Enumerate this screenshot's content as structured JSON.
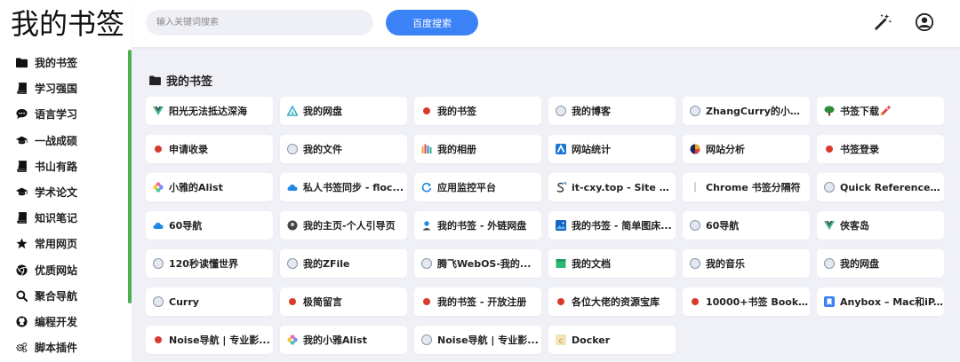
{
  "sidebar": {
    "logo": "我的书签",
    "items": [
      {
        "label": "我的书签",
        "icon": "folder-icon"
      },
      {
        "label": "学习强国",
        "icon": "book-icon"
      },
      {
        "label": "语言学习",
        "icon": "chat-icon"
      },
      {
        "label": "一战成硕",
        "icon": "graduation-cap-icon"
      },
      {
        "label": "书山有路",
        "icon": "book-icon"
      },
      {
        "label": "学术论文",
        "icon": "graduation-cap-icon"
      },
      {
        "label": "知识笔记",
        "icon": "book-icon"
      },
      {
        "label": "常用网页",
        "icon": "star-icon"
      },
      {
        "label": "优质网站",
        "icon": "chrome-icon"
      },
      {
        "label": "聚合导航",
        "icon": "search-icon"
      },
      {
        "label": "编程开发",
        "icon": "github-icon"
      },
      {
        "label": "脚本插件",
        "icon": "gears-icon"
      }
    ]
  },
  "header": {
    "search_placeholder": "输入关键词搜索",
    "search_button": "百度搜索"
  },
  "section": {
    "title": "我的书签"
  },
  "bookmarks": [
    {
      "label": "阳光无法抵达深海",
      "icon": "vue-icon"
    },
    {
      "label": "我的网盘",
      "icon": "triangle-icon"
    },
    {
      "label": "我的书签",
      "icon": "red-dot-icon"
    },
    {
      "label": "我的博客",
      "icon": "globe-icon"
    },
    {
      "label": "ZhangCurry的小破站",
      "icon": "globe-icon"
    },
    {
      "label": "书签下载",
      "icon": "tree-icon",
      "badge": "rocket-icon"
    },
    {
      "label": "申请收录",
      "icon": "red-dot-icon"
    },
    {
      "label": "我的文件",
      "icon": "globe-icon"
    },
    {
      "label": "我的相册",
      "icon": "bars-icon"
    },
    {
      "label": "网站统计",
      "icon": "analytics-icon"
    },
    {
      "label": "网站分析",
      "icon": "pie-icon"
    },
    {
      "label": "书签登录",
      "icon": "red-dot-icon"
    },
    {
      "label": "小雅的Alist",
      "icon": "flower-icon"
    },
    {
      "label": "私人书签同步 - floc...",
      "icon": "cloud-icon"
    },
    {
      "label": "应用监控平台",
      "icon": "refresh-icon"
    },
    {
      "label": "it-cxy.top - Site R...",
      "icon": "s-arrow-icon"
    },
    {
      "label": "Chrome 书签分隔符",
      "icon": "divider-icon"
    },
    {
      "label": "Quick Reference ...",
      "icon": "globe-icon"
    },
    {
      "label": "60导航",
      "icon": "cloud-icon"
    },
    {
      "label": "我的主页-个人引导页",
      "icon": "dark-circle-icon"
    },
    {
      "label": "我的书签 - 外链网盘",
      "icon": "person-icon"
    },
    {
      "label": "我的书签 - 简单图床...",
      "icon": "image-icon"
    },
    {
      "label": "60导航",
      "icon": "globe-icon"
    },
    {
      "label": "侠客岛",
      "icon": "vue-icon"
    },
    {
      "label": "120秒读懂世界",
      "icon": "globe-icon"
    },
    {
      "label": "我的ZFile",
      "icon": "globe-icon"
    },
    {
      "label": "腾飞WebOS-我的...",
      "icon": "globe-icon"
    },
    {
      "label": "我的文档",
      "icon": "doc-icon"
    },
    {
      "label": "我的音乐",
      "icon": "globe-icon"
    },
    {
      "label": "我的网盘",
      "icon": "globe-icon"
    },
    {
      "label": "Curry",
      "icon": "globe-icon"
    },
    {
      "label": "极简留言",
      "icon": "red-dot-icon"
    },
    {
      "label": "我的书签 - 开放注册",
      "icon": "red-dot-icon"
    },
    {
      "label": "各位大佬的资源宝库",
      "icon": "red-dot-icon"
    },
    {
      "label": "10000+书签 Book...",
      "icon": "red-dot-icon"
    },
    {
      "label": "Anybox – Mac和iP...",
      "icon": "anybox-icon"
    },
    {
      "label": "Noise导航 | 专业影...",
      "icon": "red-dot-icon"
    },
    {
      "label": "我的小雅Alist",
      "icon": "flower-icon"
    },
    {
      "label": "Noise导航 | 专业影...",
      "icon": "globe-icon"
    },
    {
      "label": "Docker",
      "icon": "docker-icon"
    }
  ],
  "colors": {
    "accent": "#3b82f6",
    "sidebar_scroll": "#4caf50",
    "background": "#f0f1f7"
  }
}
